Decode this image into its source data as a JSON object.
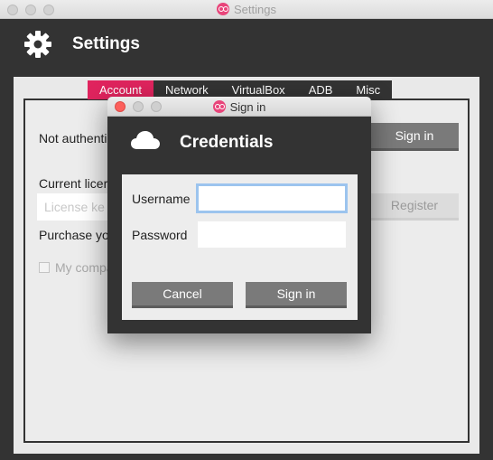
{
  "window": {
    "title": "Settings",
    "header_title": "Settings",
    "traffic_lights": [
      "#d2d2d2",
      "#d2d2d2",
      "#d2d2d2"
    ]
  },
  "tabs": [
    {
      "label": "Account",
      "active": true
    },
    {
      "label": "Network",
      "active": false
    },
    {
      "label": "VirtualBox",
      "active": false
    },
    {
      "label": "ADB",
      "active": false
    },
    {
      "label": "Misc",
      "active": false
    }
  ],
  "account": {
    "auth_status": "Not authenti",
    "sign_in_button": "Sign in",
    "license_label": "Current licer",
    "license_placeholder": "License ke",
    "register_button": "Register",
    "purchase_text": "Purchase you",
    "company_checkbox_label": "My compa"
  },
  "dialog": {
    "title": "Sign in",
    "heading": "Credentials",
    "username_label": "Username",
    "username_value": "",
    "password_label": "Password",
    "password_value": "",
    "cancel_button": "Cancel",
    "sign_in_button": "Sign in",
    "traffic_lights": [
      "#fc605c",
      "#c8c8c8",
      "#c8c8c8"
    ]
  },
  "colors": {
    "accent": "#e0245e",
    "dark": "#333333",
    "button": "#7a7a7a",
    "logo": "#e8457a"
  }
}
